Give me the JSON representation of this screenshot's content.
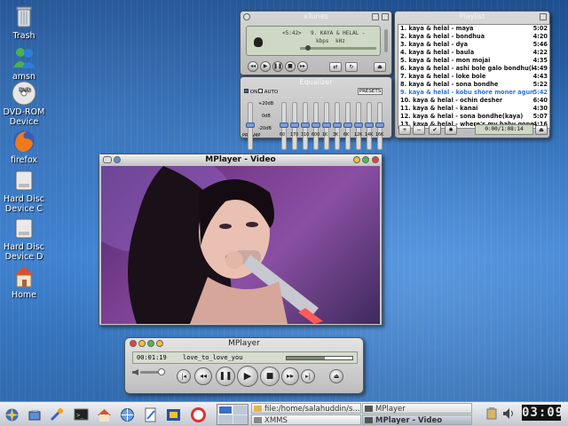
{
  "desktop": {
    "icons": [
      {
        "label": "Trash",
        "icon": "trash-icon"
      },
      {
        "label": "amsn",
        "icon": "amsn-icon"
      },
      {
        "label": "DVD-ROM Device",
        "icon": "dvd-icon"
      },
      {
        "label": "firefox",
        "icon": "firefox-icon"
      },
      {
        "label": "Hard Disc Device C",
        "icon": "hard-disk-icon"
      },
      {
        "label": "Hard Disc Device D",
        "icon": "hard-disk-icon"
      },
      {
        "label": "Home",
        "icon": "home-icon"
      }
    ]
  },
  "xtunes": {
    "title": "xTunes",
    "display_line1": "<5:42>",
    "display_line2": "9. KAYA & HELAL -",
    "kbps": "kbps",
    "khz": "kHz"
  },
  "playlist": {
    "title": "Playlist",
    "items": [
      {
        "title": "1. kaya & helal - maya",
        "time": "5:02"
      },
      {
        "title": "2. kaya & helal - bondhua",
        "time": "4:20"
      },
      {
        "title": "3. kaya & helal - dya",
        "time": "5:46"
      },
      {
        "title": "4. kaya & helal - baula",
        "time": "4:22"
      },
      {
        "title": "5. kaya & helal - mon mojai",
        "time": "4:35"
      },
      {
        "title": "6. kaya & helal - ashi bole galo bondhu(krishn...",
        "time": "4:49"
      },
      {
        "title": "7. kaya & helal - loke bole",
        "time": "4:43"
      },
      {
        "title": "8. kaya & helal - sona bondhe",
        "time": "5:22"
      },
      {
        "title": "9. kaya & helal - kobu shore moner agun",
        "time": "5:42",
        "active": true
      },
      {
        "title": "10. kaya & helal - ochin desher",
        "time": "6:40"
      },
      {
        "title": "11. kaya & helal - kanai",
        "time": "4:30"
      },
      {
        "title": "12. kaya & helal - sona bondhe(kaya)",
        "time": "5:07"
      },
      {
        "title": "13. kaya & helal - where's my baby gone ?",
        "time": "4:16"
      }
    ],
    "total_time": "0:00/1:08:14"
  },
  "equalizer": {
    "title": "Equalizer",
    "on_label": "ON",
    "auto_label": "AUTO",
    "presets_label": "PRESETS",
    "db_labels": [
      "+20dB",
      "0dB",
      "-20dB"
    ],
    "preamp_label": "PREAMP",
    "bands": [
      "60",
      "170",
      "310",
      "600",
      "1K",
      "3K",
      "6K",
      "12K",
      "14K",
      "16K"
    ]
  },
  "video_window": {
    "title": "MPlayer - Video"
  },
  "mplayer": {
    "title": "MPlayer",
    "time": "00:01:19",
    "track": "love_to_love_you",
    "progress": 0.58
  },
  "taskbar": {
    "tasks": [
      {
        "label": "file:/home/salahuddin/s..."
      },
      {
        "label": "MPlayer"
      },
      {
        "label": "XMMS"
      },
      {
        "label": "MPlayer - Video",
        "active": true
      }
    ],
    "clock": "03:09"
  },
  "colors": {
    "accent": "#2b73d9",
    "desktop": "#2c6bb5"
  }
}
